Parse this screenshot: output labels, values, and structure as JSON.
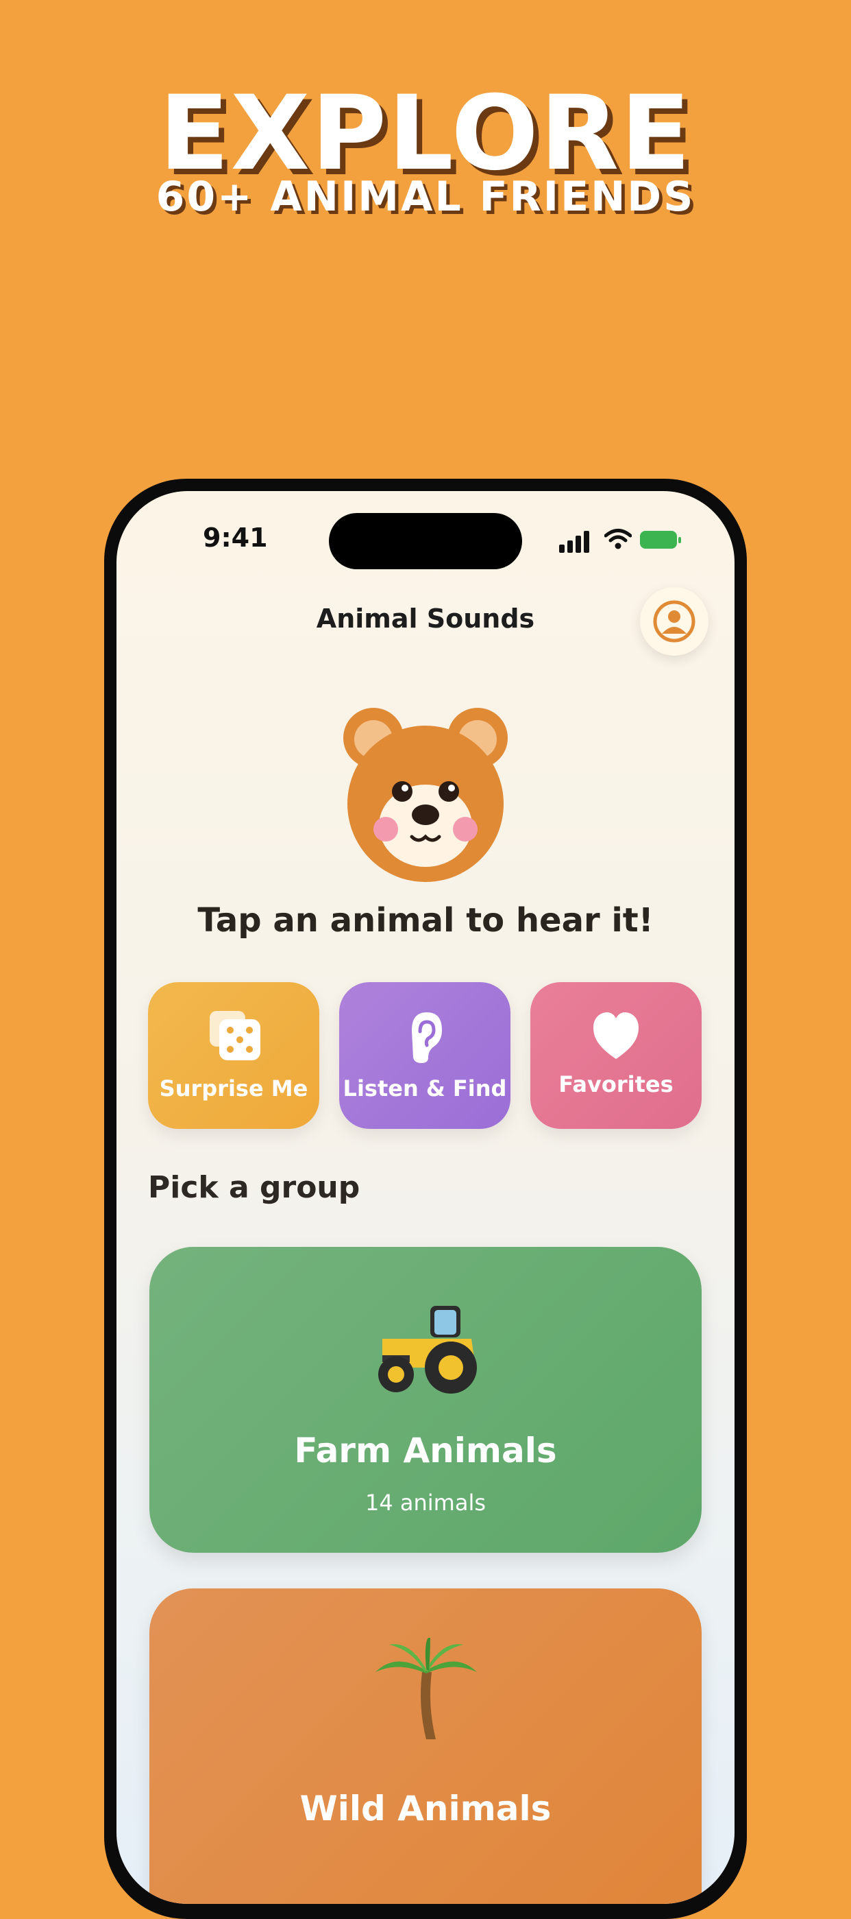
{
  "promo": {
    "headline": "EXPLORE",
    "subheadline": "60+ ANIMAL FRIENDS"
  },
  "status_bar": {
    "time": "9:41"
  },
  "app": {
    "title": "Animal Sounds",
    "prompt": "Tap an animal to hear it!"
  },
  "actions": [
    {
      "label": "Surprise Me",
      "icon": "dice-icon",
      "color": "#F0B043"
    },
    {
      "label": "Listen & Find",
      "icon": "ear-icon",
      "color": "#A277D8"
    },
    {
      "label": "Favorites",
      "icon": "heart-icon",
      "color": "#E47692"
    }
  ],
  "groups_section": {
    "title": "Pick a group"
  },
  "groups": [
    {
      "name": "Farm Animals",
      "count": "14 animals",
      "icon": "tractor-icon",
      "color": "#66AD72"
    },
    {
      "name": "Wild Animals",
      "icon": "palm-tree-icon",
      "color": "#E08A45"
    }
  ],
  "colors": {
    "background": "#F3A03E",
    "accent": "#E08A36"
  }
}
